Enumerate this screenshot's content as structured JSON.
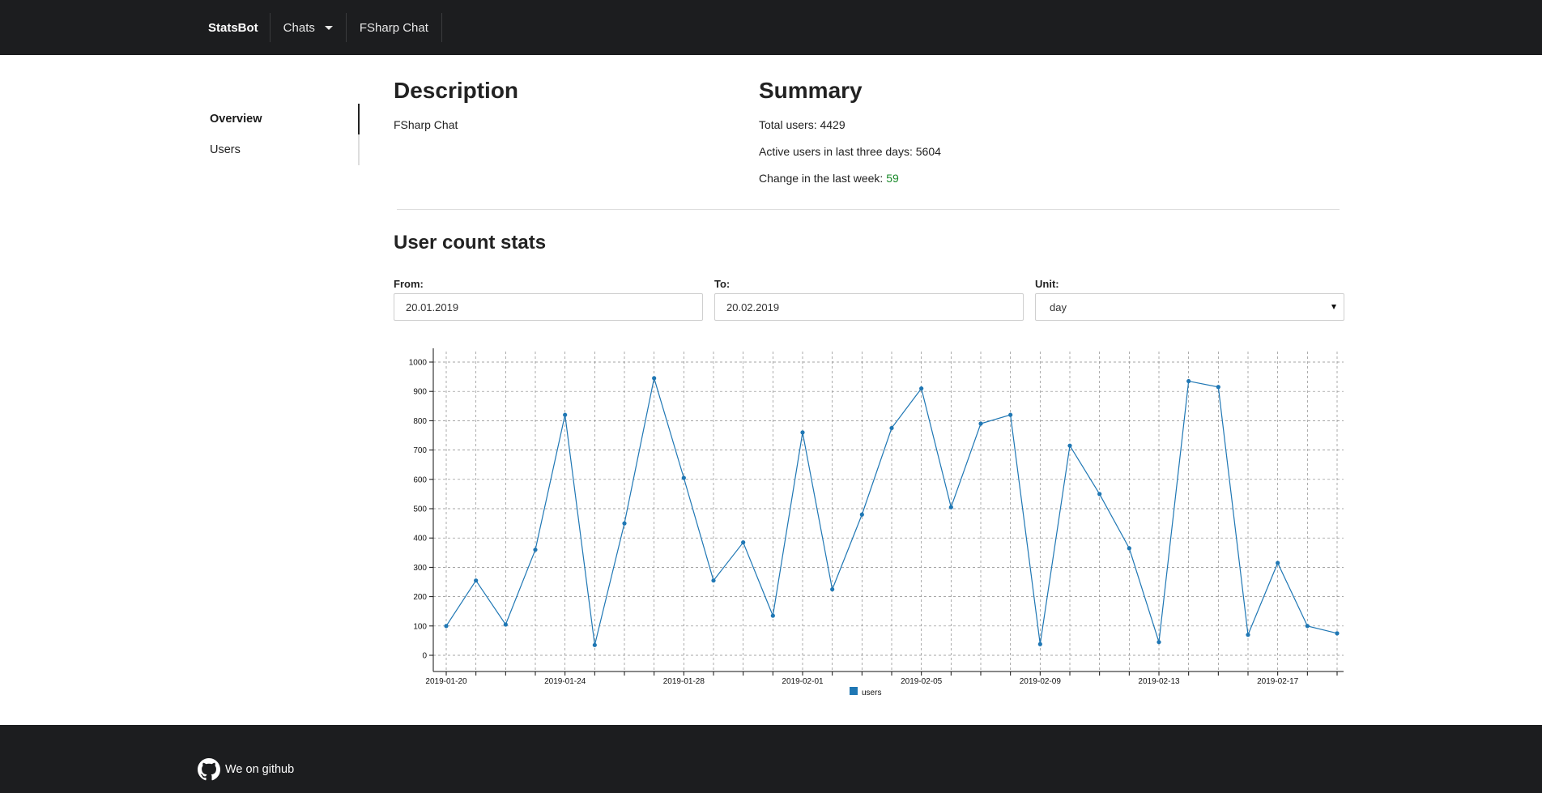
{
  "navbar": {
    "brand": "StatsBot",
    "chats_label": "Chats",
    "current_chat": "FSharp Chat"
  },
  "sidebar": {
    "items": [
      {
        "label": "Overview",
        "active": true
      },
      {
        "label": "Users",
        "active": false
      }
    ]
  },
  "description": {
    "heading": "Description",
    "text": "FSharp Chat"
  },
  "summary": {
    "heading": "Summary",
    "total_users_label": "Total users:",
    "total_users": "4429",
    "active_label": "Active users in last three days:",
    "active_users": "5604",
    "change_label": "Change in the last week:",
    "change_value": "59",
    "change_color": "#1a8a2a"
  },
  "stats": {
    "heading": "User count stats",
    "from_label": "From:",
    "from_value": "20.01.2019",
    "to_label": "To:",
    "to_value": "20.02.2019",
    "unit_label": "Unit:",
    "unit_value": "day"
  },
  "chart_data": {
    "type": "line",
    "x": [
      "2019-01-20",
      "2019-01-21",
      "2019-01-22",
      "2019-01-23",
      "2019-01-24",
      "2019-01-25",
      "2019-01-26",
      "2019-01-27",
      "2019-01-28",
      "2019-01-29",
      "2019-01-30",
      "2019-01-31",
      "2019-02-01",
      "2019-02-02",
      "2019-02-03",
      "2019-02-04",
      "2019-02-05",
      "2019-02-06",
      "2019-02-07",
      "2019-02-08",
      "2019-02-09",
      "2019-02-10",
      "2019-02-11",
      "2019-02-12",
      "2019-02-13",
      "2019-02-14",
      "2019-02-15",
      "2019-02-16",
      "2019-02-17",
      "2019-02-18",
      "2019-02-19"
    ],
    "x_tick_labels": [
      "2019-01-20",
      "2019-01-24",
      "2019-01-28",
      "2019-02-01",
      "2019-02-05",
      "2019-02-09",
      "2019-02-13",
      "2019-02-17"
    ],
    "series": [
      {
        "name": "users",
        "color": "#1f77b4",
        "values": [
          100,
          255,
          105,
          360,
          820,
          35,
          450,
          945,
          605,
          255,
          385,
          135,
          760,
          225,
          480,
          775,
          910,
          505,
          790,
          820,
          38,
          715,
          550,
          365,
          45,
          935,
          915,
          70,
          315,
          100,
          75
        ]
      }
    ],
    "ylim": [
      0,
      1000
    ],
    "y_ticks": [
      0,
      100,
      200,
      300,
      400,
      500,
      600,
      700,
      800,
      900,
      1000
    ],
    "grid": true,
    "legend": "bottom-center"
  },
  "footer": {
    "github_label": "We on github",
    "icon": "github-icon"
  }
}
